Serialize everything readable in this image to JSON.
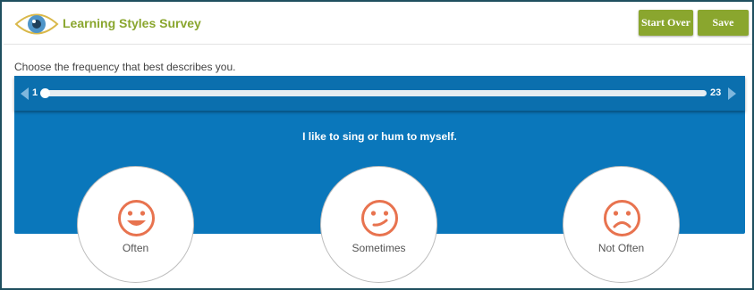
{
  "header": {
    "logo_icon": "eye-icon",
    "title": "Learning Styles Survey",
    "start_over_label": "Start Over",
    "save_label": "Save"
  },
  "instruction": "Choose the frequency that best describes you.",
  "slider": {
    "min_label": "1",
    "max_label": "23",
    "current": 1,
    "total": 23
  },
  "question": "I like to sing or hum to myself.",
  "options": [
    {
      "label": "Often",
      "icon": "happy-face-icon"
    },
    {
      "label": "Sometimes",
      "icon": "neutral-face-icon"
    },
    {
      "label": "Not Often",
      "icon": "sad-face-icon"
    }
  ],
  "colors": {
    "brand_green": "#8aa62e",
    "panel_blue": "#0a77bb",
    "face_orange": "#e8734f",
    "frame_border": "#1f4f5f"
  }
}
